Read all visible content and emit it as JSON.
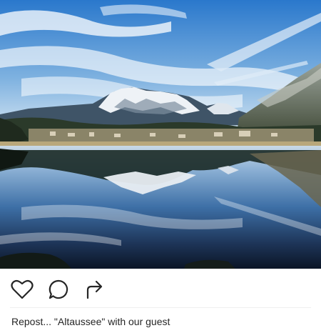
{
  "post": {
    "photo": {
      "subject": "mountain-lake-reflection",
      "colors": {
        "sky_top": "#2f7fd0",
        "sky_bottom": "#d9e9f5",
        "snow": "#eef2f6",
        "forest": "#2b3a2a",
        "water_dark": "#0e1a2e"
      }
    },
    "actions": {
      "like_icon": "heart-outline",
      "comment_icon": "speech-bubble",
      "share_icon": "share-arrow"
    },
    "caption": {
      "username": "",
      "text": "Repost... \"Altaussee\" with our guest"
    }
  }
}
